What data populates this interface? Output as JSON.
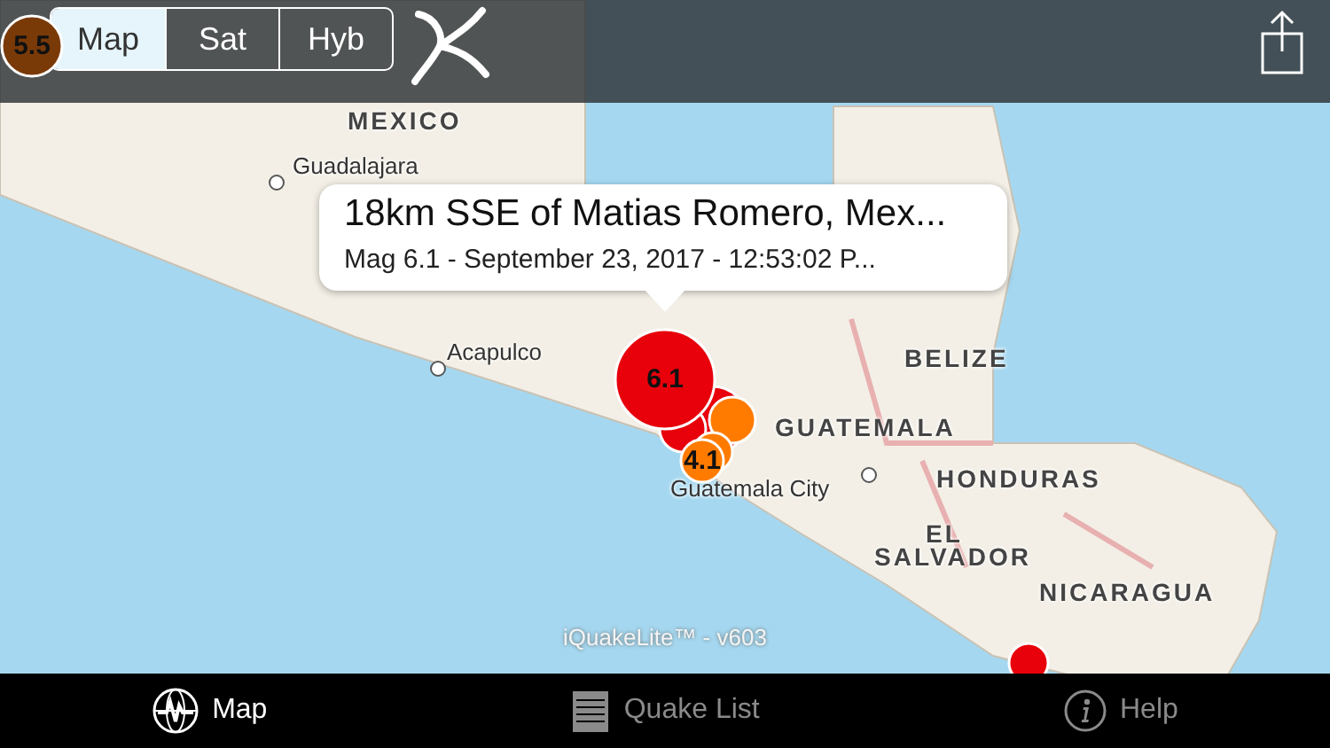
{
  "segments": [
    {
      "label": "Map",
      "selected": true
    },
    {
      "label": "Sat",
      "selected": false
    },
    {
      "label": "Hyb",
      "selected": false
    }
  ],
  "map_labels": [
    {
      "text": "MEXICO",
      "kind": "country"
    },
    {
      "text": "Guadalajara",
      "kind": "city"
    },
    {
      "text": "Acapulco",
      "kind": "city"
    },
    {
      "text": "BELIZE",
      "kind": "country"
    },
    {
      "text": "GUATEMALA",
      "kind": "country"
    },
    {
      "text": "Guatemala City",
      "kind": "city"
    },
    {
      "text": "HONDURAS",
      "kind": "country"
    },
    {
      "text": "EL",
      "kind": "country"
    },
    {
      "text": "SALVADOR",
      "kind": "country"
    },
    {
      "text": "NICARAGUA",
      "kind": "country"
    }
  ],
  "markers": [
    {
      "label": "5.5",
      "color": "#7a3a08"
    },
    {
      "color": "#e8000b"
    },
    {
      "color": "#e8000b"
    },
    {
      "color": "#ff7b00"
    },
    {
      "color": "#ff7b00"
    },
    {
      "label": "6.1",
      "color": "#e8000b"
    },
    {
      "label": "4.1",
      "color": "#ff7b00"
    },
    {
      "color": "#e8000b"
    }
  ],
  "callout": {
    "title": "18km SSE of Matias Romero, Mex...",
    "subtitle": "Mag 6.1 - September 23, 2017 - 12:53:02 P..."
  },
  "watermark": "iQuakeLite™ - v603",
  "tabs": [
    {
      "label": "Map",
      "kind": "globe",
      "selected": true
    },
    {
      "label": "Quake List",
      "kind": "list",
      "selected": false
    },
    {
      "label": "Help",
      "kind": "info",
      "selected": false
    }
  ]
}
